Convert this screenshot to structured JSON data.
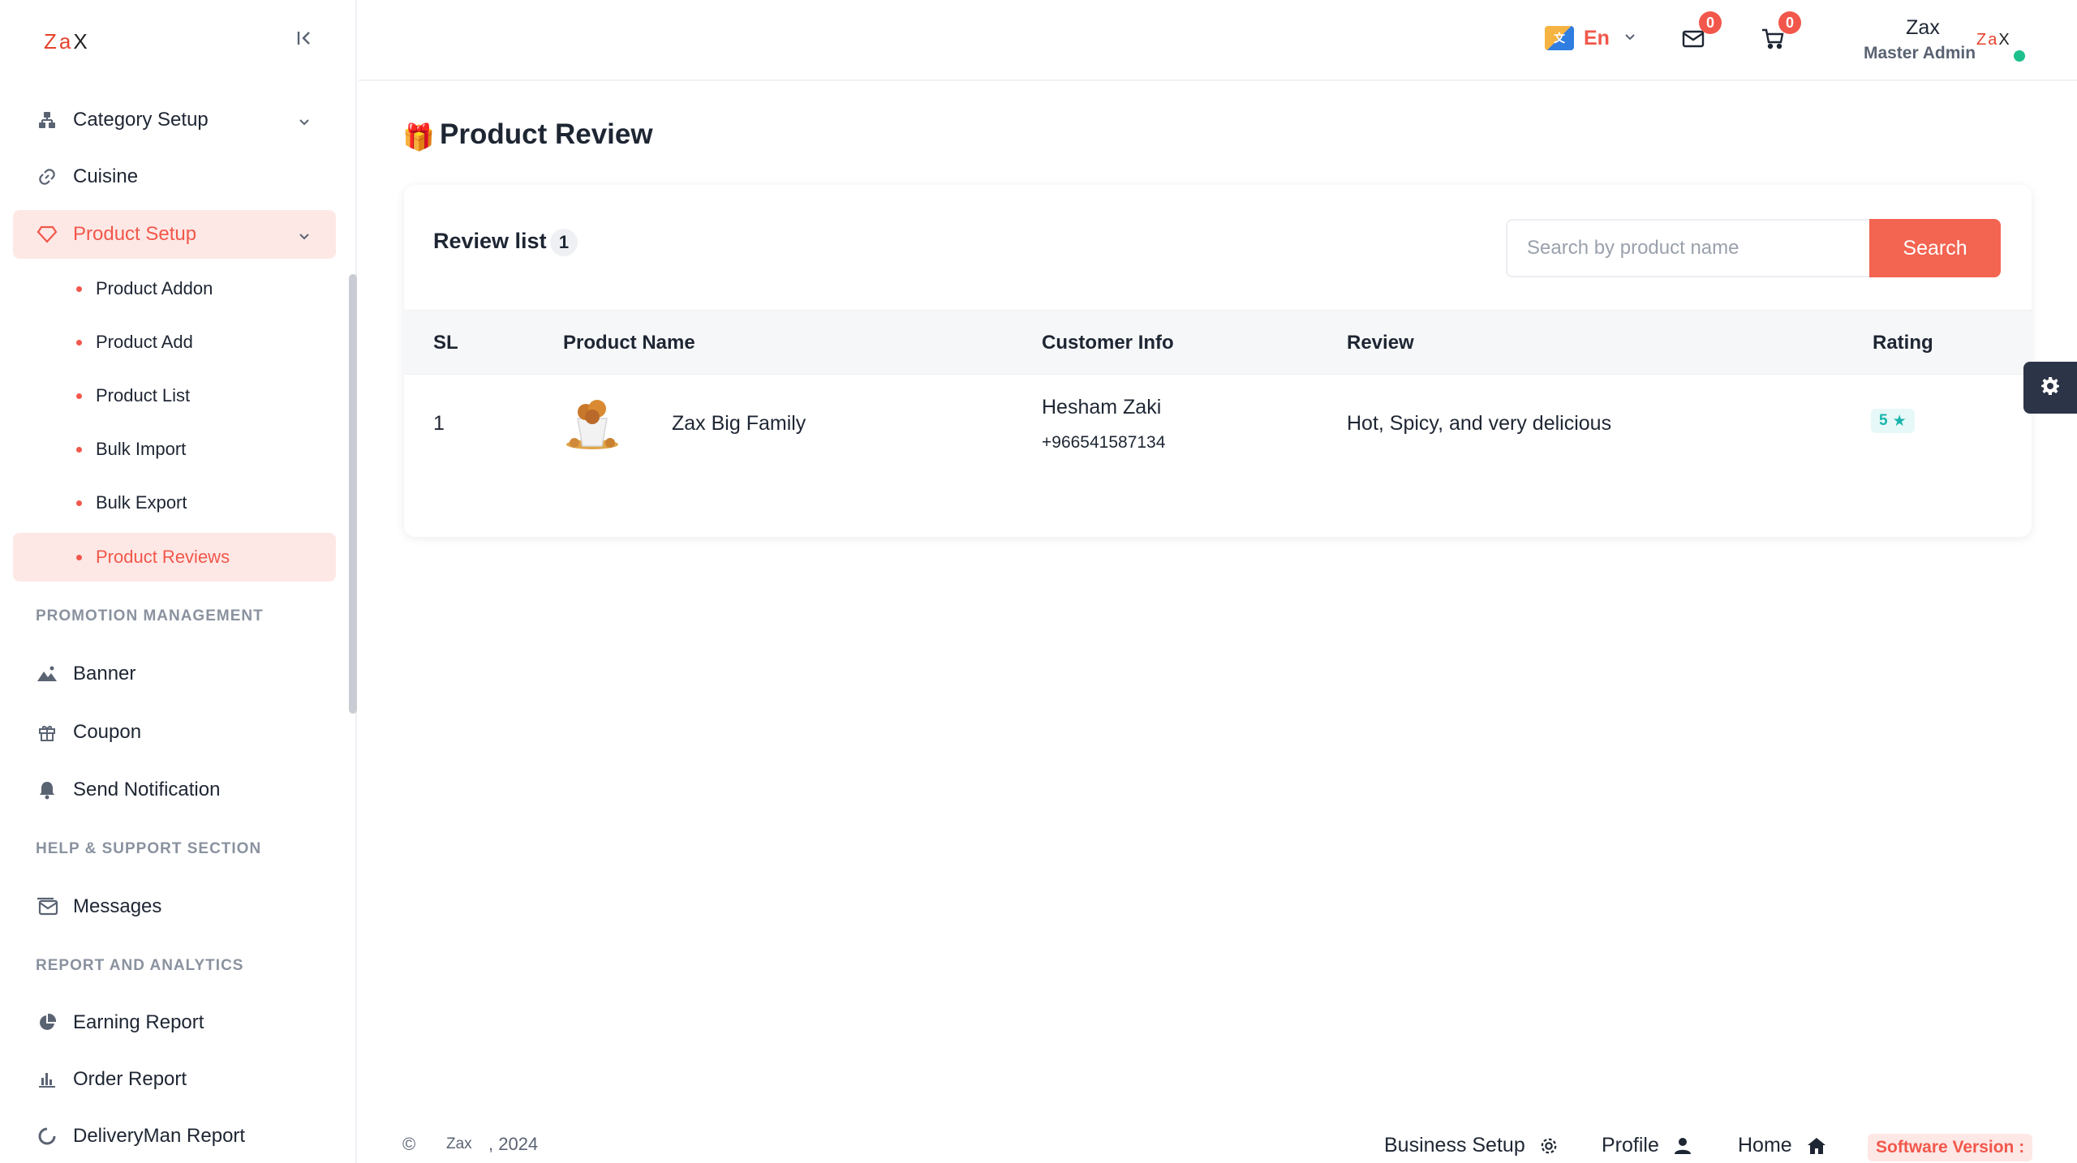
{
  "brand": {
    "logo_text": "Za",
    "logo_x": "X"
  },
  "sidebar": {
    "items": [
      {
        "label": "Category Setup",
        "icon": "sitemap-icon"
      },
      {
        "label": "Cuisine",
        "icon": "link-icon"
      },
      {
        "label": "Product Setup",
        "icon": "diamond-icon"
      }
    ],
    "product_setup_sub": [
      {
        "label": "Product Addon"
      },
      {
        "label": "Product Add"
      },
      {
        "label": "Product List"
      },
      {
        "label": "Bulk Import"
      },
      {
        "label": "Bulk Export"
      },
      {
        "label": "Product Reviews"
      }
    ],
    "promotion_title": "PROMOTION MANAGEMENT",
    "promotion": [
      {
        "label": "Banner",
        "icon": "image-icon"
      },
      {
        "label": "Coupon",
        "icon": "gift-icon"
      },
      {
        "label": "Send Notification",
        "icon": "bell-icon"
      }
    ],
    "help_title": "HELP & SUPPORT SECTION",
    "help": [
      {
        "label": "Messages",
        "icon": "messages-icon"
      }
    ],
    "report_title": "REPORT AND ANALYTICS",
    "reports": [
      {
        "label": "Earning Report",
        "icon": "pie-chart-icon"
      },
      {
        "label": "Order Report",
        "icon": "bar-chart-icon"
      },
      {
        "label": "DeliveryMan Report",
        "icon": "spinner-icon"
      }
    ]
  },
  "header": {
    "language": "En",
    "messages_count": "0",
    "cart_count": "0",
    "user_name": "Zax",
    "user_role": "Master Admin",
    "avatar_text": "Za",
    "avatar_x": "X"
  },
  "page": {
    "title": "Product Review",
    "card_title": "Review list",
    "count": "1",
    "search_placeholder": "Search by product name",
    "search_button": "Search"
  },
  "table": {
    "columns": [
      "SL",
      "Product Name",
      "Customer Info",
      "Review",
      "Rating"
    ],
    "rows": [
      {
        "sl": "1",
        "product": "Zax Big Family",
        "customer_name": "Hesham Zaki",
        "customer_phone": "+966541587134",
        "review": "Hot, Spicy, and very delicious",
        "rating": "5"
      }
    ]
  },
  "footer": {
    "copyright_symbol": "©",
    "brand": "Zax",
    "year": ", 2024",
    "business_setup": "Business Setup",
    "profile": "Profile",
    "home": "Home",
    "version": "Software Version :"
  },
  "colors": {
    "accent": "#f2574b",
    "active_bg": "#fde8e6",
    "rating_text": "#19b5ad",
    "online": "#1dc08c"
  }
}
